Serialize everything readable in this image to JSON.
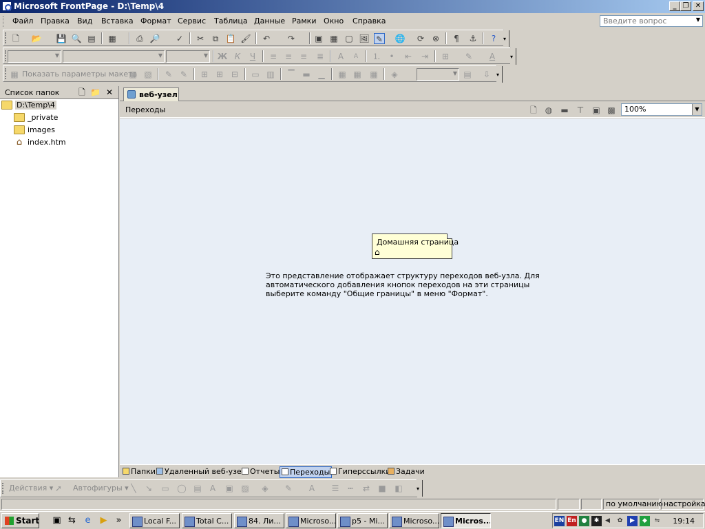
{
  "window": {
    "title": "Microsoft FrontPage - D:\\Temp\\4"
  },
  "menu": {
    "items": [
      "Файл",
      "Правка",
      "Вид",
      "Вставка",
      "Формат",
      "Сервис",
      "Таблица",
      "Данные",
      "Рамки",
      "Окно",
      "Справка"
    ],
    "ask_placeholder": "Введите вопрос"
  },
  "layout_toolbar": {
    "label": "Показать параметры макета"
  },
  "folders": {
    "title": "Список папок",
    "root": "D:\\Temp\\4",
    "items": [
      {
        "name": "_private",
        "icon": "folder-icon"
      },
      {
        "name": "images",
        "icon": "folder-icon"
      },
      {
        "name": "index.htm",
        "icon": "home-page-icon"
      }
    ]
  },
  "main": {
    "tab": "веб-узел",
    "view_title": "Переходы",
    "zoom": "100%",
    "home_node": "Домашняя страница",
    "info": "Это представление отображает структуру переходов веб-узла. Для автоматического добавления кнопок переходов на эти страницы выберите команду \"Общие границы\" в меню \"Формат\"."
  },
  "view_tabs": [
    "Папки",
    "Удаленный веб-узел",
    "Отчеты",
    "Переходы",
    "Гиперссылки",
    "Задачи"
  ],
  "drawing": {
    "actions": "Действия",
    "autoshapes": "Автофигуры"
  },
  "status": {
    "style": "по умолчанию",
    "settings": "настройка"
  },
  "taskbar": {
    "start": "Start",
    "tasks": [
      "Local F...",
      "Total C...",
      "84. Ли...",
      "Microso...",
      "p5 - Mi...",
      "Microso...",
      "Micros..."
    ],
    "lang1": "EN",
    "lang2": "En",
    "time": "19:14"
  }
}
